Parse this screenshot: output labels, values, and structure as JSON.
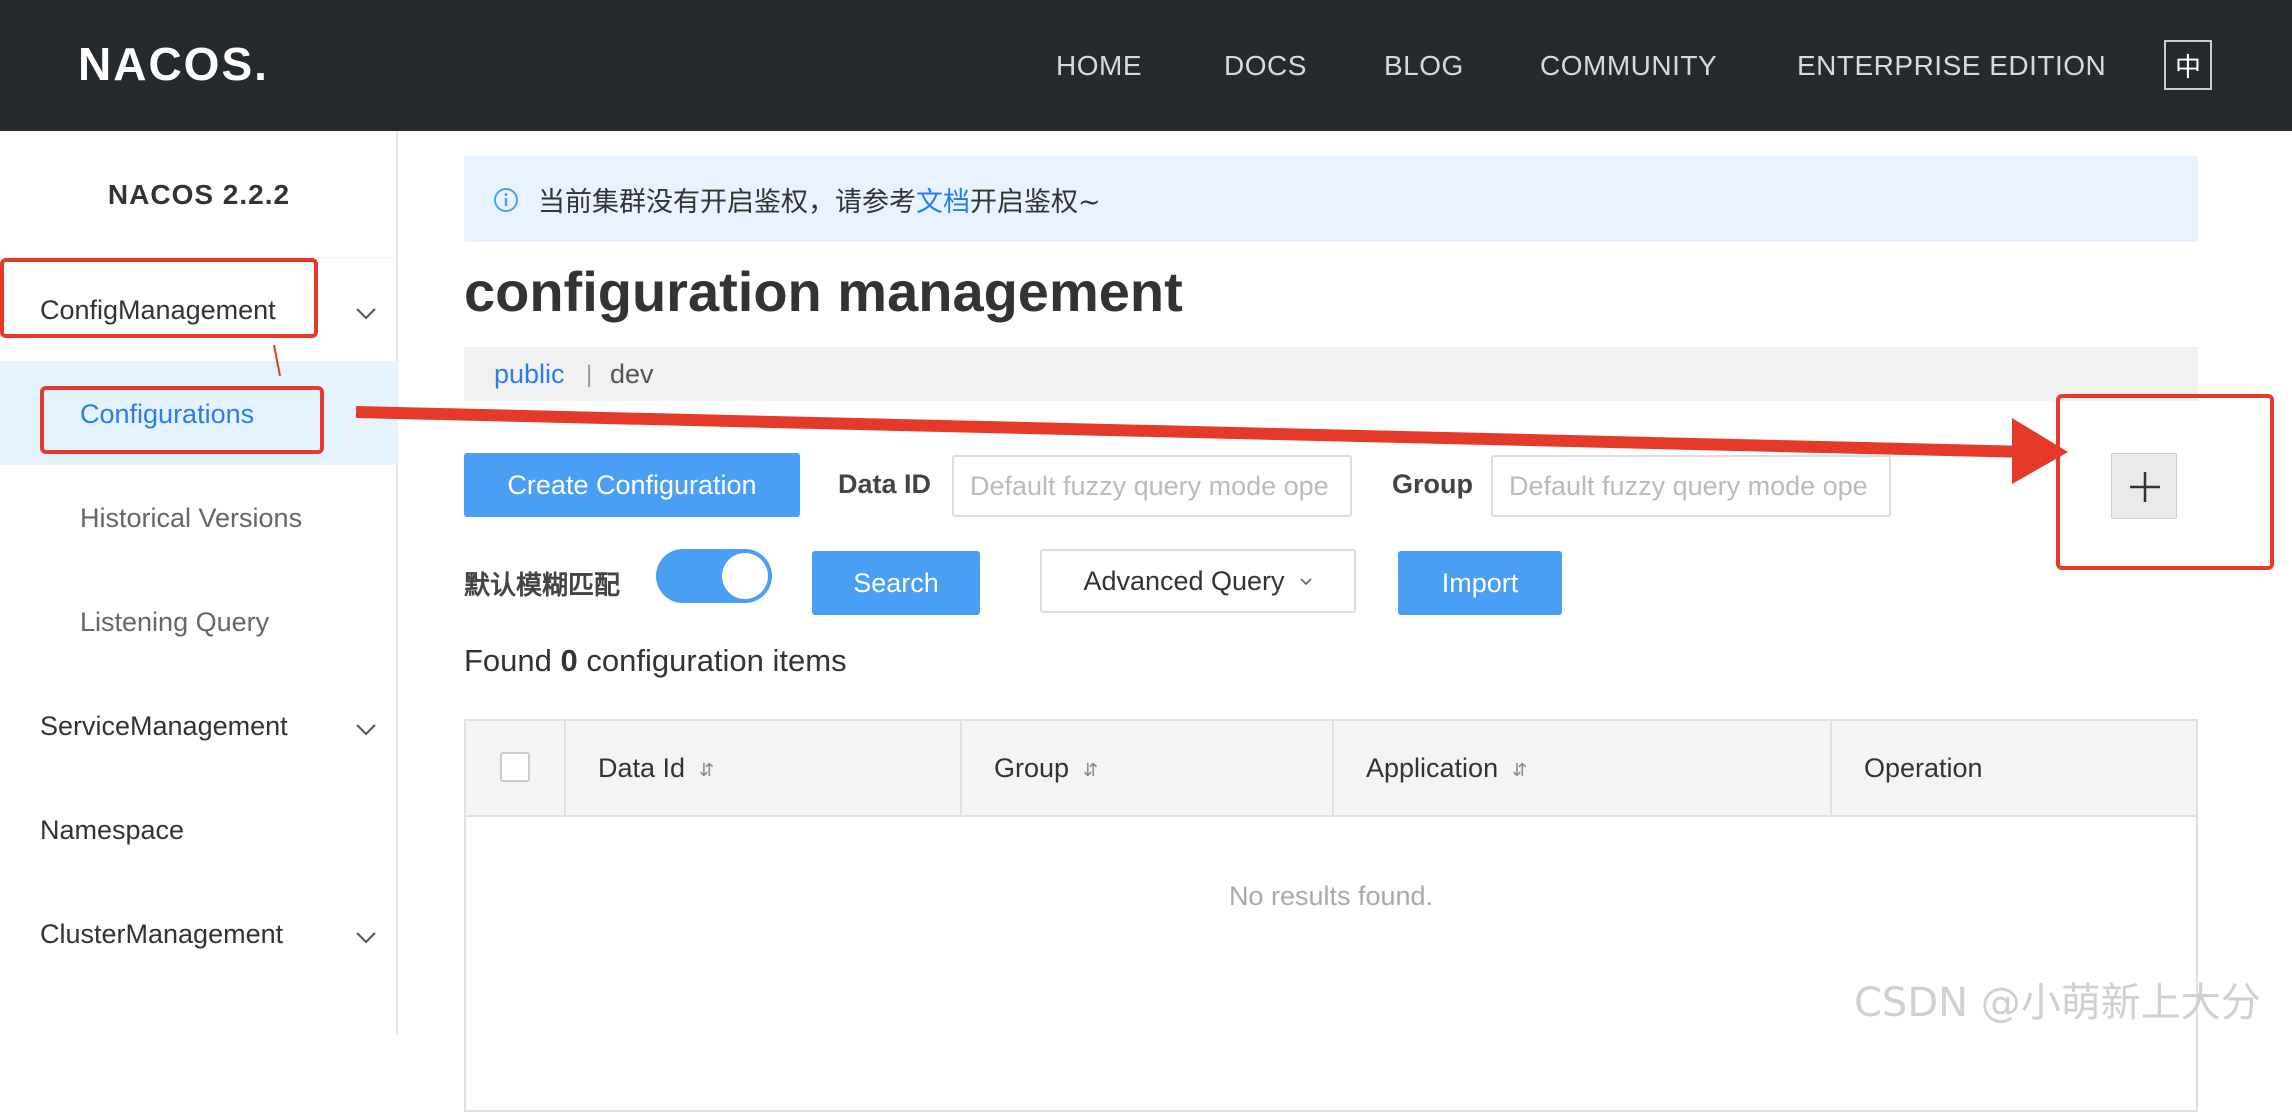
{
  "header": {
    "logo": "NACOS.",
    "nav": [
      "HOME",
      "DOCS",
      "BLOG",
      "COMMUNITY",
      "ENTERPRISE EDITION"
    ],
    "lang_toggle": "中"
  },
  "sidebar": {
    "version": "NACOS 2.2.2",
    "config_management": "ConfigManagement",
    "configurations": "Configurations",
    "historical_versions": "Historical Versions",
    "listening_query": "Listening Query",
    "service_management": "ServiceManagement",
    "namespace": "Namespace",
    "cluster_management": "ClusterManagement"
  },
  "alert": {
    "before": "当前集群没有开启鉴权，请参考",
    "link": "文档",
    "after": "开启鉴权~"
  },
  "main": {
    "title": "configuration management",
    "namespaces": {
      "public": "public",
      "separator": "|",
      "dev": "dev"
    }
  },
  "toolbar": {
    "create_label": "Create Configuration",
    "data_id_label": "Data ID",
    "data_id_placeholder": "Default fuzzy query mode ope",
    "group_label": "Group",
    "group_placeholder": "Default fuzzy query mode ope",
    "plus_label": "+",
    "fuzzy_label": "默认模糊匹配",
    "fuzzy_on": true,
    "search_label": "Search",
    "advanced_label": "Advanced Query",
    "import_label": "Import"
  },
  "results": {
    "prefix": "Found",
    "count": "0",
    "suffix": "configuration items"
  },
  "table": {
    "columns": [
      "Data Id",
      "Group",
      "Application",
      "Operation"
    ],
    "sort_glyph": "⇵",
    "empty": "No results found."
  },
  "watermark": "CSDN @小萌新上大分",
  "colors": {
    "topbar": "#252a2f",
    "primary": "#4a9ef3",
    "link": "#2b7de9",
    "annotation": "#e53a2a",
    "alert_bg": "#e8f3ff",
    "active_bg": "#e5f3ff"
  }
}
